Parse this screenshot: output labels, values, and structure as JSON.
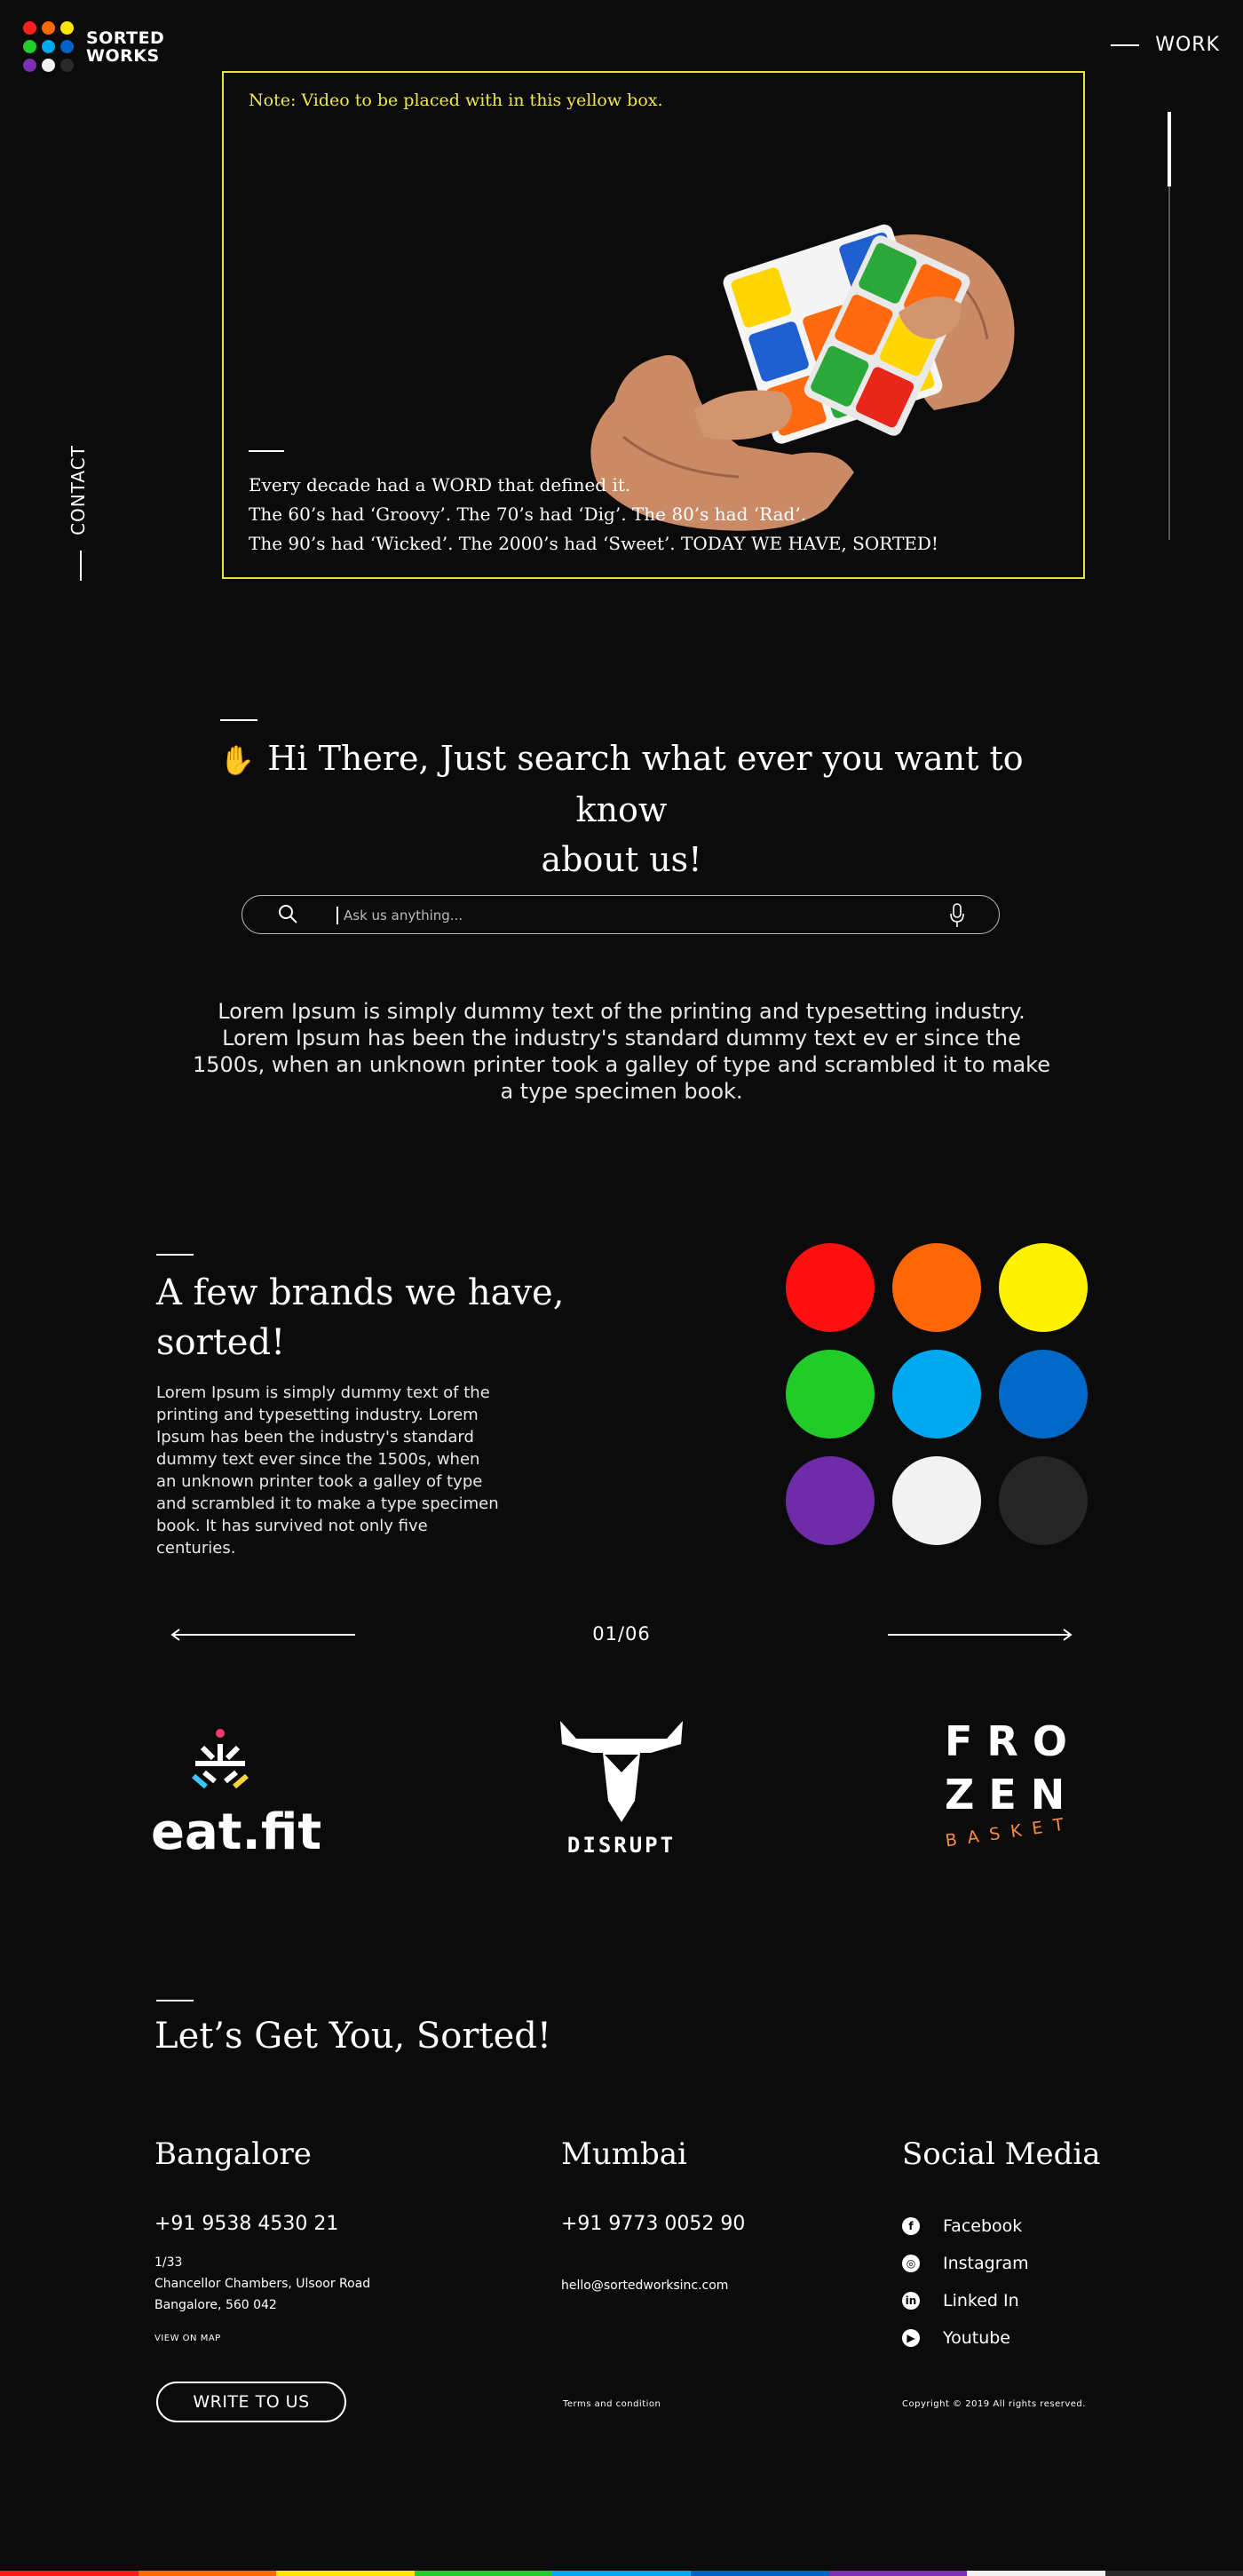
{
  "brand": {
    "line1": "SORTED",
    "line2": "WORKS"
  },
  "logo_dot_colors": [
    "#ff1f1f",
    "#ff6a00",
    "#ffe500",
    "#22cc2a",
    "#00a8f0",
    "#0063c6",
    "#7b2fb3",
    "#f2f2f2",
    "#2a2a2a"
  ],
  "nav": {
    "work": "WORK",
    "contact": "CONTACT"
  },
  "hero": {
    "note": "Note: Video to be placed with in this yellow box.",
    "lines": [
      "Every decade had a WORD that defined it.",
      "The 60’s had ‘Groovy’. The 70’s had ‘Dig’. The 80’s had ‘Rad’.",
      "The 90’s had ‘Wicked’. The 2000’s had ‘Sweet’. TODAY WE HAVE, SORTED!"
    ]
  },
  "hi": {
    "line1": "Hi There, Just search what ever you want to know",
    "line2": "about us!",
    "search_placeholder": "Ask us anything...",
    "description": "Lorem Ipsum is simply dummy text of the printing and typesetting industry. Lorem Ipsum has been the industry's standard dummy text ev er since the 1500s, when an unknown printer took a galley of type and scrambled it to make a type specimen book."
  },
  "brands": {
    "title": "A few brands we have, sorted!",
    "description": "Lorem Ipsum is simply dummy text of the printing and typesetting industry. Lorem Ipsum has been the industry's standard dummy text ever since the 1500s, when an unknown printer took a galley of type and scrambled it to make a type specimen book. It has survived not only five centuries.",
    "circle_colors": [
      "#ff1010",
      "#ff6608",
      "#fff200",
      "#22cc28",
      "#00a8f0",
      "#0068c6",
      "#6e2ca8",
      "#f2f2f2",
      "#262626"
    ],
    "counter": "01/06",
    "logos": [
      {
        "name": "eat.fit"
      },
      {
        "name": "DISRUPT"
      },
      {
        "top": "FRO",
        "mid": "ZEN",
        "bottom": "BASKET"
      }
    ]
  },
  "contact": {
    "title": "Let’s Get You, Sorted!",
    "bangalore": {
      "title": "Bangalore",
      "phone": "+91 9538 4530 21",
      "address1": "1/33",
      "address2": "Chancellor Chambers, Ulsoor Road",
      "address3": "Bangalore, 560 042",
      "map_link": "VIEW ON MAP",
      "button": "WRITE TO US"
    },
    "mumbai": {
      "title": "Mumbai",
      "phone": "+91 9773 0052 90",
      "email": "hello@sortedworksinc.com",
      "terms": "Terms and condition"
    },
    "social": {
      "title": "Social Media",
      "items": [
        "Facebook",
        "Instagram",
        "Linked In",
        "Youtube"
      ],
      "copyright": "Copyright © 2019 All rights reserved."
    }
  },
  "footer_bar_colors": [
    "#ff1a1a",
    "#ff6a00",
    "#ffe500",
    "#22cc2a",
    "#00a8f0",
    "#0063c6",
    "#7b2fb3",
    "#f2f2f2",
    "#2a2a2a"
  ]
}
